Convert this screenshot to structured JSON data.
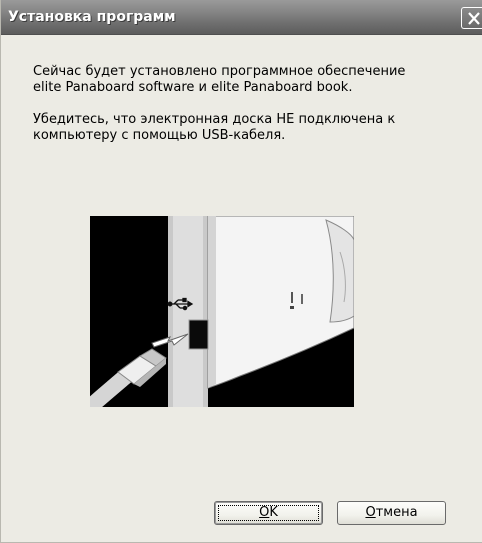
{
  "window": {
    "title": "Установка программ"
  },
  "message": {
    "line1": "Сейчас будет установлено программное обеспечение",
    "line2": "elite Panaboard software и elite Panaboard book.",
    "line3": "Убедитесь, что электронная доска НЕ подключена к",
    "line4": "компьютеру с помощью USB-кабеля."
  },
  "buttons": {
    "ok_mnemonic": "O",
    "ok_rest": "K",
    "cancel_mnemonic": "О",
    "cancel_rest": "тмена"
  },
  "icons": {
    "close": "close-icon",
    "usb": "usb-icon",
    "arrow": "arrow-icon"
  }
}
